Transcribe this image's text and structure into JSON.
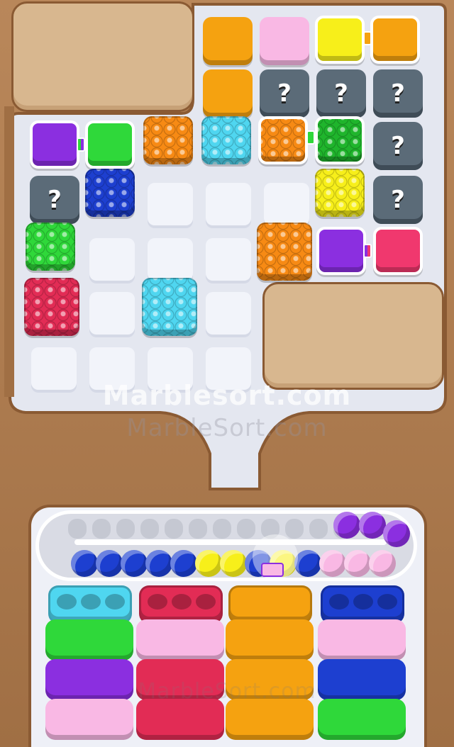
{
  "watermarks": {
    "primary": "Marblesort.com",
    "secondary": "MarbleSort.com",
    "tray": "MarbleSort.com"
  },
  "board": {
    "mystery_symbol": "?",
    "colors": {
      "orange": "#f5a210",
      "pink": "#f9b8e4",
      "yellow": "#f7ef1a",
      "purple": "#8b2fe0",
      "green": "#2fd83a",
      "cyan": "#4fd6f0",
      "blue": "#1d3fd0",
      "red": "#e22c55",
      "bright_orange": "#f78a14",
      "hot_pink": "#f0386e"
    }
  },
  "conveyor": {
    "balls": [
      "blue",
      "blue",
      "blue",
      "blue",
      "blue",
      "yellow",
      "yellow",
      "blue",
      "yellow",
      "blue",
      "pink",
      "pink",
      "pink",
      "purple",
      "purple",
      "purple"
    ]
  },
  "columns": [
    {
      "top": "cyan",
      "stack": [
        "green",
        "purple",
        "pink"
      ]
    },
    {
      "top": "red",
      "stack": [
        "pink",
        "red",
        "red"
      ]
    },
    {
      "top": "orange",
      "stack": [
        "orange",
        "orange",
        "orange"
      ]
    },
    {
      "top": "blue",
      "stack": [
        "pink",
        "blue",
        "green"
      ]
    }
  ]
}
